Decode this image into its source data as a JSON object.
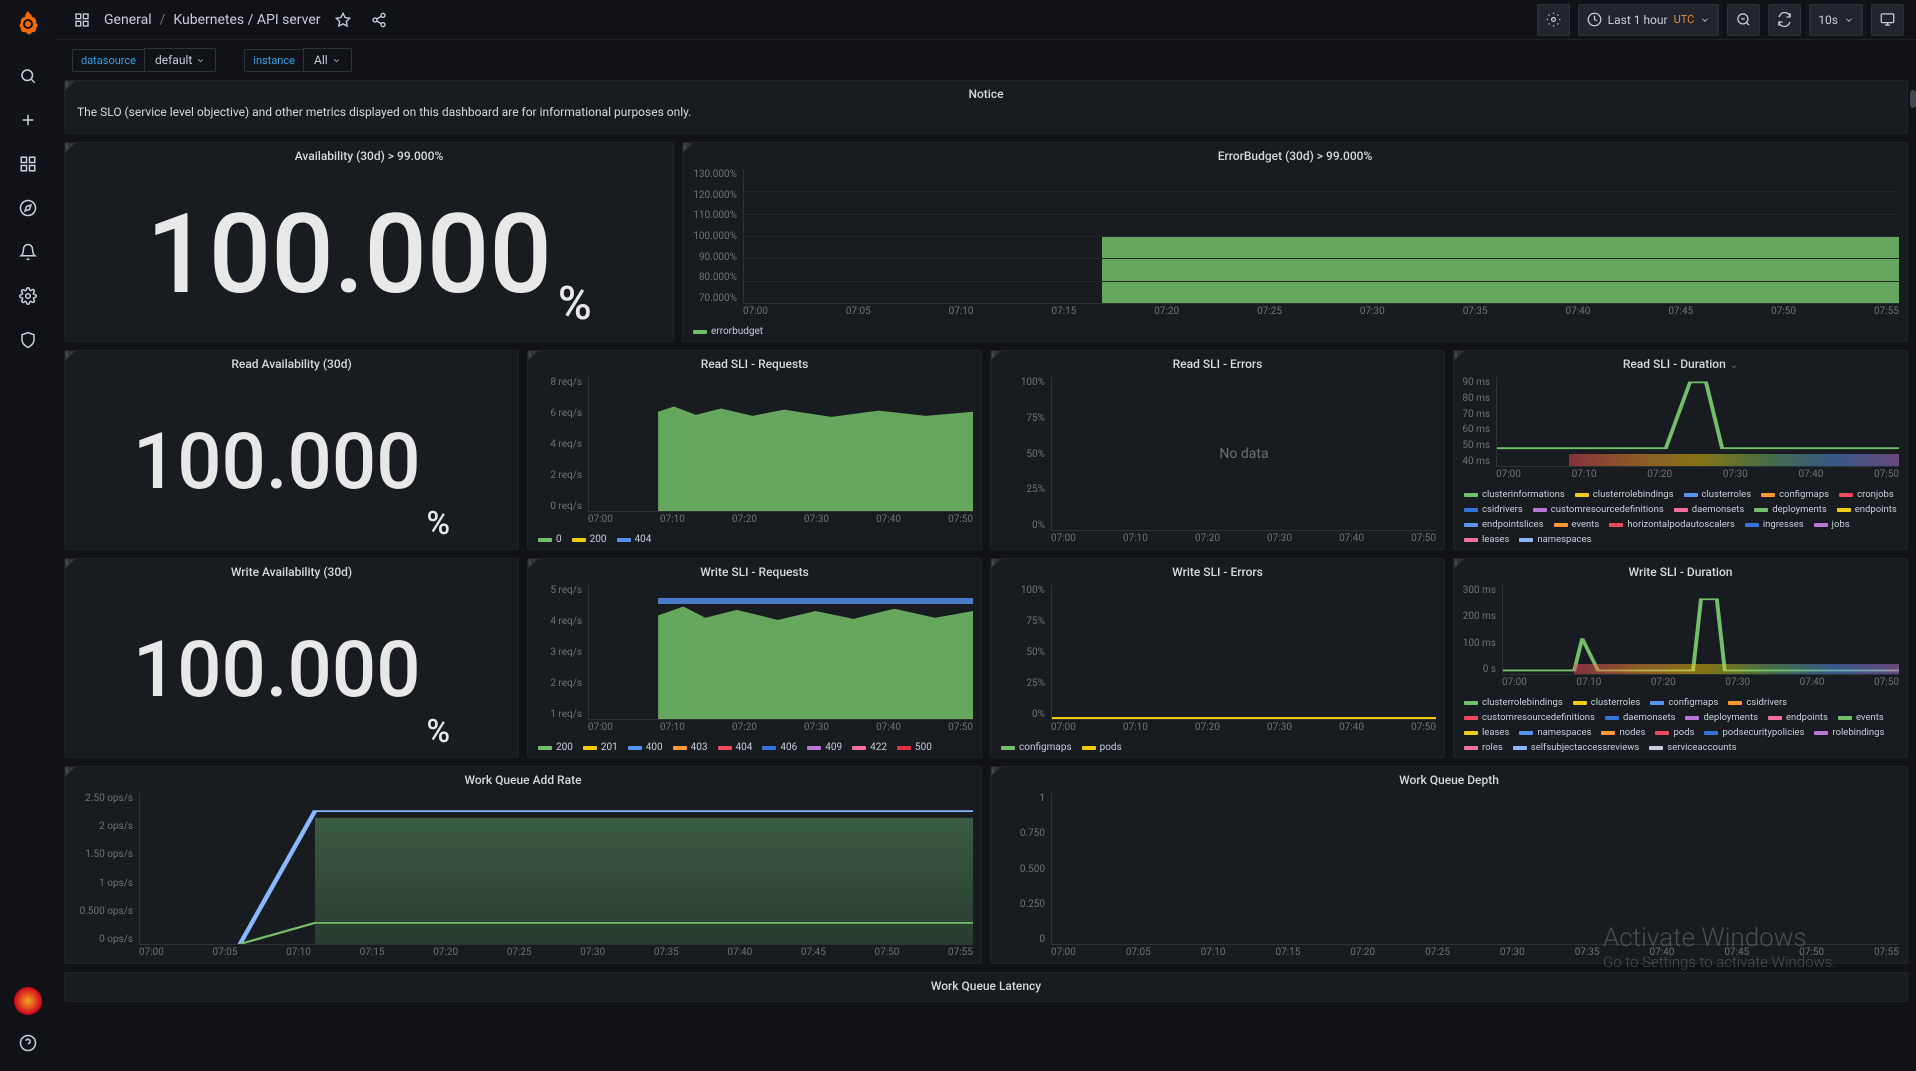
{
  "breadcrumb": {
    "root_icon": "apps",
    "path": [
      "General",
      "Kubernetes / API server"
    ]
  },
  "topbar": {
    "time_label": "Last 1 hour",
    "tz": "UTC",
    "refresh_interval": "10s"
  },
  "vars": {
    "datasource": {
      "label": "datasource",
      "value": "default"
    },
    "instance": {
      "label": "instance",
      "value": "All"
    }
  },
  "notice": {
    "title": "Notice",
    "text": "The SLO (service level objective) and other metrics displayed on this dashboard are for informational purposes only."
  },
  "panels": {
    "availability": {
      "title": "Availability (30d) > 99.000%",
      "value": "100.000",
      "unit": "%"
    },
    "error_budget": {
      "title": "ErrorBudget (30d) > 99.000%",
      "legend": "errorbudget"
    },
    "read_availability": {
      "title": "Read Availability (30d)",
      "value": "100.000",
      "unit": "%"
    },
    "read_requests": {
      "title": "Read SLI - Requests"
    },
    "read_errors": {
      "title": "Read SLI - Errors",
      "nodata": "No data"
    },
    "read_duration": {
      "title": "Read SLI - Duration"
    },
    "write_availability": {
      "title": "Write Availability (30d)",
      "value": "100.000",
      "unit": "%"
    },
    "write_requests": {
      "title": "Write SLI - Requests"
    },
    "write_errors": {
      "title": "Write SLI - Errors"
    },
    "write_duration": {
      "title": "Write SLI - Duration"
    },
    "add_rate": {
      "title": "Work Queue Add Rate"
    },
    "depth": {
      "title": "Work Queue Depth"
    },
    "latency": {
      "title": "Work Queue Latency"
    }
  },
  "legend_colors": {
    "green": "#73bf69",
    "yellow": "#f2cc0c",
    "blue": "#5794f2",
    "orange": "#ff9830",
    "red": "#f2495c",
    "darkblue": "#3274d9",
    "purple": "#b877d9",
    "pink": "#fa6e9c",
    "teal": "#37872d",
    "lightblue": "#8ab8ff"
  },
  "legends": {
    "read_requests_items": [
      {
        "label": "0",
        "color": "#73bf69"
      },
      {
        "label": "200",
        "color": "#f2cc0c"
      },
      {
        "label": "404",
        "color": "#5794f2"
      }
    ],
    "write_requests_items": [
      {
        "label": "200",
        "color": "#73bf69"
      },
      {
        "label": "201",
        "color": "#f2cc0c"
      },
      {
        "label": "400",
        "color": "#5794f2"
      },
      {
        "label": "403",
        "color": "#ff9830"
      },
      {
        "label": "404",
        "color": "#f2495c"
      },
      {
        "label": "406",
        "color": "#3274d9"
      },
      {
        "label": "409",
        "color": "#b877d9"
      },
      {
        "label": "422",
        "color": "#fa6e9c"
      },
      {
        "label": "500",
        "color": "#e02f44"
      }
    ],
    "write_errors_items": [
      {
        "label": "configmaps",
        "color": "#73bf69"
      },
      {
        "label": "pods",
        "color": "#f2cc0c"
      }
    ],
    "read_duration_items": [
      {
        "label": "clusterinformations",
        "color": "#73bf69"
      },
      {
        "label": "clusterrolebindings",
        "color": "#f2cc0c"
      },
      {
        "label": "clusterroles",
        "color": "#5794f2"
      },
      {
        "label": "configmaps",
        "color": "#ff9830"
      },
      {
        "label": "cronjobs",
        "color": "#f2495c"
      },
      {
        "label": "csidrivers",
        "color": "#3274d9"
      },
      {
        "label": "customresourcedefinitions",
        "color": "#b877d9"
      },
      {
        "label": "daemonsets",
        "color": "#fa6e9c"
      },
      {
        "label": "deployments",
        "color": "#73bf69"
      },
      {
        "label": "endpoints",
        "color": "#f2cc0c"
      },
      {
        "label": "endpointslices",
        "color": "#5794f2"
      },
      {
        "label": "events",
        "color": "#ff9830"
      },
      {
        "label": "horizontalpodautoscalers",
        "color": "#f2495c"
      },
      {
        "label": "ingresses",
        "color": "#3274d9"
      },
      {
        "label": "jobs",
        "color": "#b877d9"
      },
      {
        "label": "leases",
        "color": "#fa6e9c"
      },
      {
        "label": "namespaces",
        "color": "#8ab8ff"
      }
    ],
    "write_duration_items": [
      {
        "label": "clusterrolebindings",
        "color": "#73bf69"
      },
      {
        "label": "clusterroles",
        "color": "#f2cc0c"
      },
      {
        "label": "configmaps",
        "color": "#5794f2"
      },
      {
        "label": "csidrivers",
        "color": "#ff9830"
      },
      {
        "label": "customresourcedefinitions",
        "color": "#f2495c"
      },
      {
        "label": "daemonsets",
        "color": "#3274d9"
      },
      {
        "label": "deployments",
        "color": "#b877d9"
      },
      {
        "label": "endpoints",
        "color": "#fa6e9c"
      },
      {
        "label": "events",
        "color": "#73bf69"
      },
      {
        "label": "leases",
        "color": "#f2cc0c"
      },
      {
        "label": "namespaces",
        "color": "#5794f2"
      },
      {
        "label": "nodes",
        "color": "#ff9830"
      },
      {
        "label": "pods",
        "color": "#f2495c"
      },
      {
        "label": "podsecuritypolicies",
        "color": "#3274d9"
      },
      {
        "label": "rolebindings",
        "color": "#b877d9"
      },
      {
        "label": "roles",
        "color": "#fa6e9c"
      },
      {
        "label": "selfsubjectaccessreviews",
        "color": "#8ab8ff"
      },
      {
        "label": "serviceaccounts",
        "color": "#c7d0d9"
      }
    ]
  },
  "chart_data": [
    {
      "panel": "error_budget",
      "type": "area",
      "x_ticks": [
        "07:00",
        "07:05",
        "07:10",
        "07:15",
        "07:20",
        "07:25",
        "07:30",
        "07:35",
        "07:40",
        "07:45",
        "07:50",
        "07:55"
      ],
      "y_ticks": [
        "70.000%",
        "80.000%",
        "90.000%",
        "100.000%",
        "110.000%",
        "120.000%",
        "130.000%"
      ],
      "ylim": [
        70,
        130
      ],
      "series": [
        {
          "name": "errorbudget",
          "start_x": "07:13",
          "value": 100
        }
      ]
    },
    {
      "panel": "read_requests",
      "type": "area",
      "x_ticks": [
        "07:00",
        "07:10",
        "07:20",
        "07:30",
        "07:40",
        "07:50"
      ],
      "y_ticks": [
        "0 req/s",
        "2 req/s",
        "4 req/s",
        "6 req/s",
        "8 req/s"
      ],
      "ylim": [
        0,
        8
      ],
      "series": [
        {
          "name": "0",
          "color": "#73bf69"
        },
        {
          "name": "200",
          "color": "#f2cc0c"
        },
        {
          "name": "404",
          "color": "#5794f2"
        }
      ],
      "approx_total_after_0705": 6.2
    },
    {
      "panel": "read_errors",
      "type": "line",
      "x_ticks": [
        "07:00",
        "07:10",
        "07:20",
        "07:30",
        "07:40",
        "07:50"
      ],
      "y_ticks": [
        "0%",
        "25%",
        "50%",
        "75%",
        "100%"
      ],
      "nodata": true
    },
    {
      "panel": "read_duration",
      "type": "line",
      "x_ticks": [
        "07:00",
        "07:10",
        "07:20",
        "07:30",
        "07:40",
        "07:50"
      ],
      "y_ticks": [
        "40 ms",
        "50 ms",
        "60 ms",
        "70 ms",
        "80 ms",
        "90 ms"
      ],
      "ylim": [
        40,
        90
      ],
      "note": "single green series spikes to ~90ms at ~07:25; baseline ~50ms"
    },
    {
      "panel": "write_requests",
      "type": "area",
      "x_ticks": [
        "07:00",
        "07:10",
        "07:20",
        "07:30",
        "07:40",
        "07:50"
      ],
      "y_ticks": [
        "1 req/s",
        "2 req/s",
        "3 req/s",
        "4 req/s",
        "5 req/s"
      ],
      "ylim": [
        1,
        5
      ],
      "approx_total_after_0705": 4.3
    },
    {
      "panel": "write_errors",
      "type": "line",
      "x_ticks": [
        "07:00",
        "07:10",
        "07:20",
        "07:30",
        "07:40",
        "07:50"
      ],
      "y_ticks": [
        "0%",
        "25%",
        "50%",
        "75%",
        "100%"
      ],
      "ylim": [
        0,
        100
      ],
      "series": [
        {
          "name": "configmaps",
          "color": "#73bf69",
          "value": 0
        },
        {
          "name": "pods",
          "color": "#f2cc0c",
          "value": 0
        }
      ]
    },
    {
      "panel": "write_duration",
      "type": "line",
      "x_ticks": [
        "07:00",
        "07:10",
        "07:20",
        "07:30",
        "07:40",
        "07:50"
      ],
      "y_ticks": [
        "0 s",
        "100 ms",
        "200 ms",
        "300 ms"
      ],
      "ylim": [
        0,
        300
      ],
      "note": "spikes ~07:10 (~100ms) and ~07:26 (~240ms)"
    },
    {
      "panel": "add_rate",
      "type": "area",
      "x_ticks": [
        "07:00",
        "07:05",
        "07:10",
        "07:15",
        "07:20",
        "07:25",
        "07:30",
        "07:35",
        "07:40",
        "07:45",
        "07:50",
        "07:55"
      ],
      "y_ticks": [
        "0 ops/s",
        "0.500 ops/s",
        "1 ops/s",
        "1.50 ops/s",
        "2 ops/s",
        "2.50 ops/s"
      ],
      "ylim": [
        0,
        2.5
      ],
      "approx_total_after_0705": 2.2
    },
    {
      "panel": "depth",
      "type": "line",
      "x_ticks": [
        "07:00",
        "07:05",
        "07:10",
        "07:15",
        "07:20",
        "07:25",
        "07:30",
        "07:35",
        "07:40",
        "07:45",
        "07:50",
        "07:55"
      ],
      "y_ticks": [
        "0",
        "0.250",
        "0.500",
        "0.750",
        "1"
      ],
      "ylim": [
        0,
        1
      ],
      "note": "no visible data"
    }
  ],
  "watermark": {
    "title": "Activate Windows",
    "sub": "Go to Settings to activate Windows."
  }
}
